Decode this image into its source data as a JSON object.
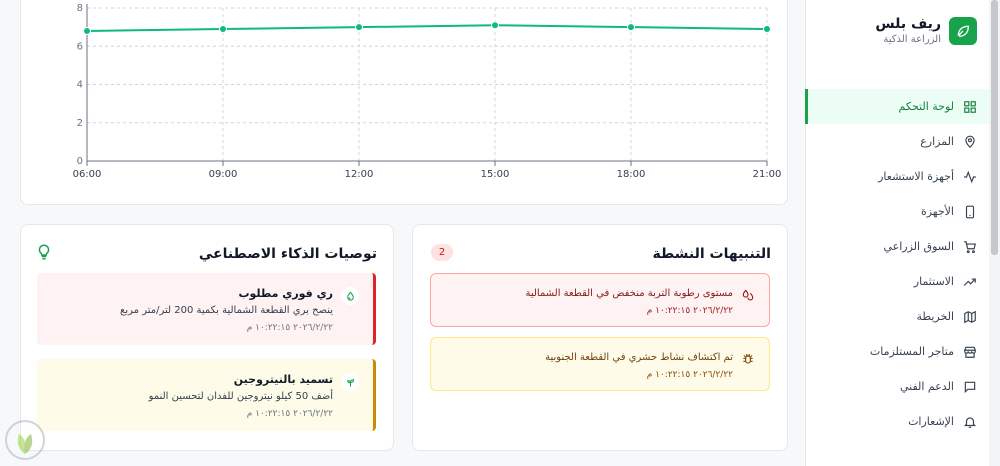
{
  "brand": {
    "name": "ريف بلس",
    "subtitle": "الزراعة الذكية",
    "accent": "#16a34a"
  },
  "nav": [
    {
      "label": "لوحة التحكم",
      "icon": "dashboard-icon",
      "active": true
    },
    {
      "label": "المزارع",
      "icon": "map-pin-icon"
    },
    {
      "label": "أجهزة الاستشعار",
      "icon": "activity-icon"
    },
    {
      "label": "الأجهزة",
      "icon": "device-icon"
    },
    {
      "label": "السوق الزراعي",
      "icon": "cart-icon"
    },
    {
      "label": "الاستثمار",
      "icon": "trending-up-icon"
    },
    {
      "label": "الخريطة",
      "icon": "map-icon"
    },
    {
      "label": "متاجر المستلزمات",
      "icon": "store-icon"
    },
    {
      "label": "الدعم الفني",
      "icon": "chat-icon"
    },
    {
      "label": "الإشعارات",
      "icon": "bell-icon"
    }
  ],
  "chart_data": {
    "type": "line",
    "x": [
      "06:00",
      "09:00",
      "12:00",
      "15:00",
      "18:00",
      "21:00"
    ],
    "series": [
      {
        "values": [
          6.8,
          6.9,
          7.0,
          7.1,
          7.0,
          6.9
        ],
        "color": "#10b981"
      }
    ],
    "ylim": [
      0,
      8
    ],
    "yticks": [
      "0",
      "2",
      "4",
      "6",
      "8"
    ],
    "grid": true
  },
  "ai": {
    "title": "توصيات الذكاء الاصطناعي",
    "bulb_color": "#16a34a",
    "items": [
      {
        "title": "ري فوري مطلوب",
        "desc": "ينصح بري القطعة الشمالية بكمية 200 لتر/متر مربع",
        "time": "٢٠٢٦/٢/٢٢ ١٠:٢٢:١٥ م",
        "icon": "droplet-icon",
        "tone": "red"
      },
      {
        "title": "تسميد بالنيتروجين",
        "desc": "أضف 50 كيلو نيتروجين للفدان لتحسين النمو",
        "time": "٢٠٢٦/٢/٢٢ ١٠:٢٢:١٥ م",
        "icon": "sprout-icon",
        "tone": "yellow"
      }
    ]
  },
  "alerts": {
    "title": "التنبيهات النشطة",
    "count": "2",
    "items": [
      {
        "title": "مستوى رطوبة التربة منخفض في القطعة الشمالية",
        "time": "٢٠٢٦/٢/٢٢ ١٠:٢٢:١٥ م",
        "icon": "droplets-icon",
        "tone": "red"
      },
      {
        "title": "تم اكتشاف نشاط حشري في القطعة الجنوبية",
        "time": "٢٠٢٦/٢/٢٢ ١٠:٢٢:١٥ م",
        "icon": "bug-icon",
        "tone": "yellow"
      }
    ]
  }
}
